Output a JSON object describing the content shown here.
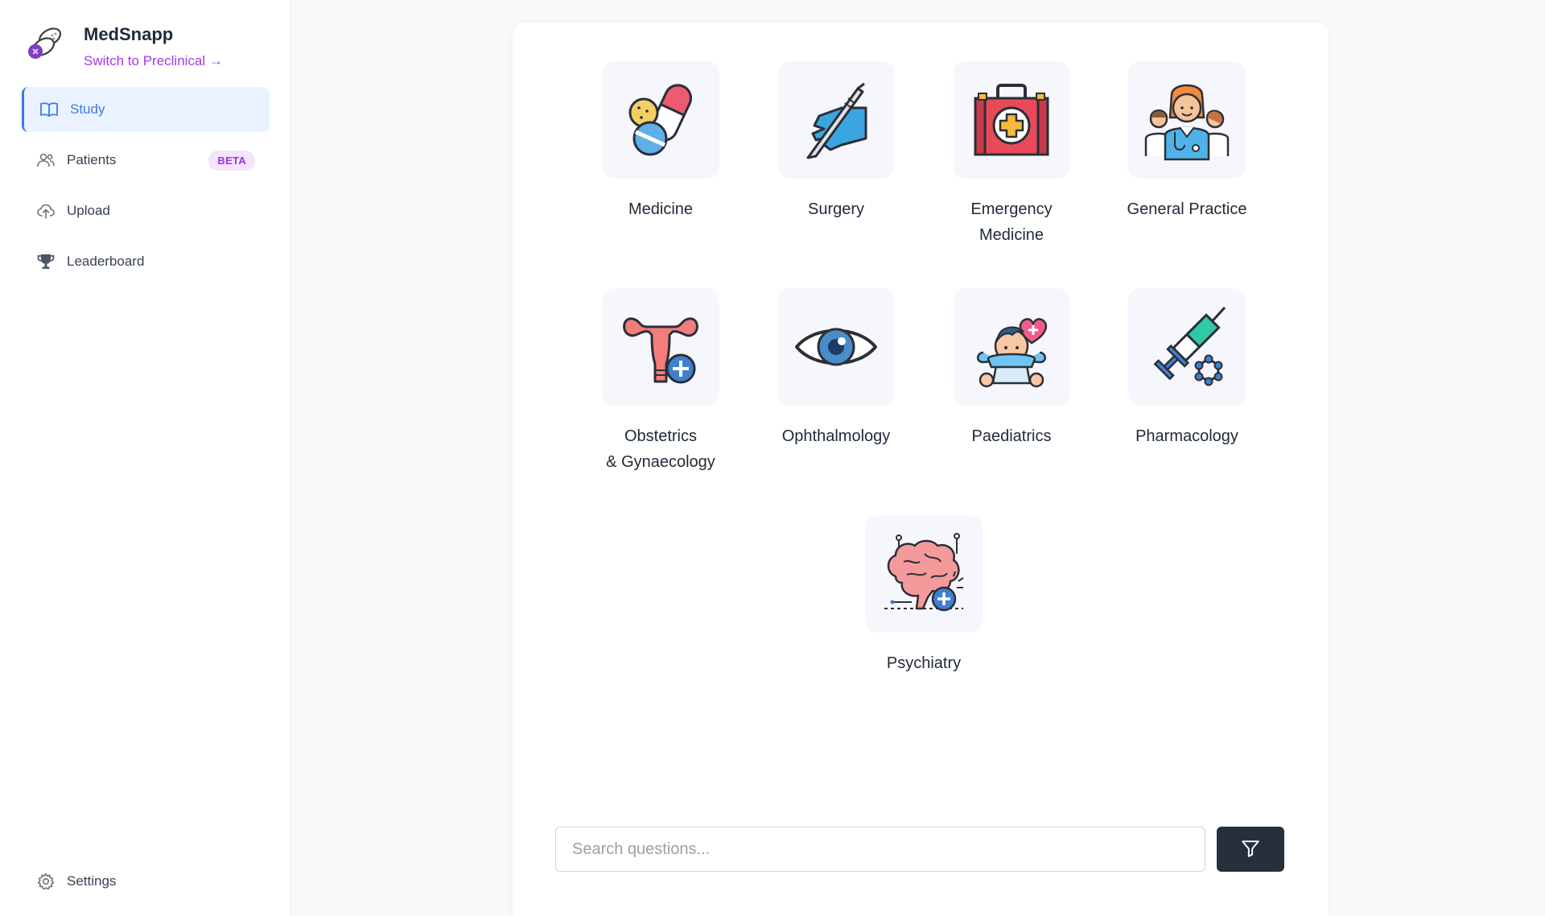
{
  "brand": {
    "name": "MedSnapp",
    "switch_label": "Switch to Preclinical →",
    "logo_icon": "medsnapp-logo-icon"
  },
  "sidebar": {
    "items": [
      {
        "label": "Study",
        "icon": "book-open-icon",
        "active": true
      },
      {
        "label": "Patients",
        "icon": "users-icon",
        "badge": "BETA"
      },
      {
        "label": "Upload",
        "icon": "cloud-upload-icon"
      },
      {
        "label": "Leaderboard",
        "icon": "trophy-icon"
      }
    ],
    "settings": {
      "label": "Settings",
      "icon": "gear-icon"
    }
  },
  "specialties": [
    {
      "label": "Medicine",
      "icon": "pills-icon"
    },
    {
      "label": "Surgery",
      "icon": "scalpel-hand-icon"
    },
    {
      "label": "Emergency\nMedicine",
      "icon": "first-aid-kit-icon"
    },
    {
      "label": "General Practice",
      "icon": "doctor-team-icon"
    },
    {
      "label": "Obstetrics\n& Gynaecology",
      "icon": "uterus-icon"
    },
    {
      "label": "Ophthalmology",
      "icon": "eye-icon"
    },
    {
      "label": "Paediatrics",
      "icon": "baby-heart-icon"
    },
    {
      "label": "Pharmacology",
      "icon": "syringe-molecule-icon"
    },
    {
      "label": "Psychiatry",
      "icon": "brain-icon"
    }
  ],
  "search": {
    "placeholder": "Search questions...",
    "value": "",
    "filter_icon": "filter-icon"
  },
  "colors": {
    "accent": "#3b7be0",
    "brand_purple": "#a33be6",
    "badge_bg": "#f3e5fd",
    "filter_button": "#262f3c"
  }
}
